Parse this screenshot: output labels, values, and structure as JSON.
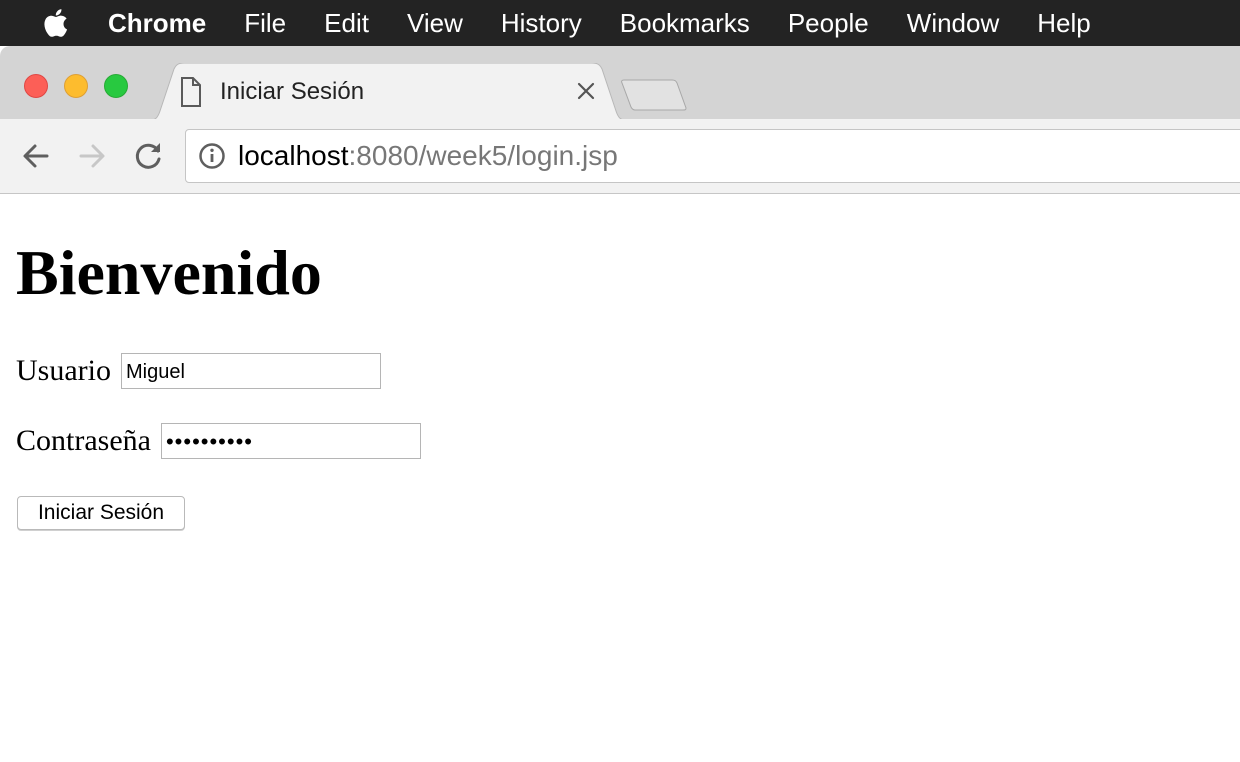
{
  "menubar": {
    "apple_icon": "apple-logo-icon",
    "app_name": "Chrome",
    "items": [
      "File",
      "Edit",
      "View",
      "History",
      "Bookmarks",
      "People",
      "Window",
      "Help"
    ]
  },
  "window": {
    "traffic_lights": {
      "close_color": "#fc5f57",
      "minimize_color": "#fdbc2e",
      "zoom_color": "#28c940"
    },
    "tab": {
      "title": "Iniciar Sesión",
      "icon": "document-icon",
      "close_icon": "close-icon"
    },
    "new_tab_icon": "new-tab-icon"
  },
  "toolbar": {
    "back_icon": "arrow-left-icon",
    "forward_icon": "arrow-right-icon",
    "reload_icon": "reload-icon",
    "info_icon": "info-icon",
    "url_host": "localhost",
    "url_rest": ":8080/week5/login.jsp"
  },
  "page": {
    "heading": "Bienvenido",
    "user_label": "Usuario",
    "user_value": "Miguel",
    "password_label": "Contraseña",
    "password_value": "••••••••••",
    "submit_label": "Iniciar Sesión"
  }
}
